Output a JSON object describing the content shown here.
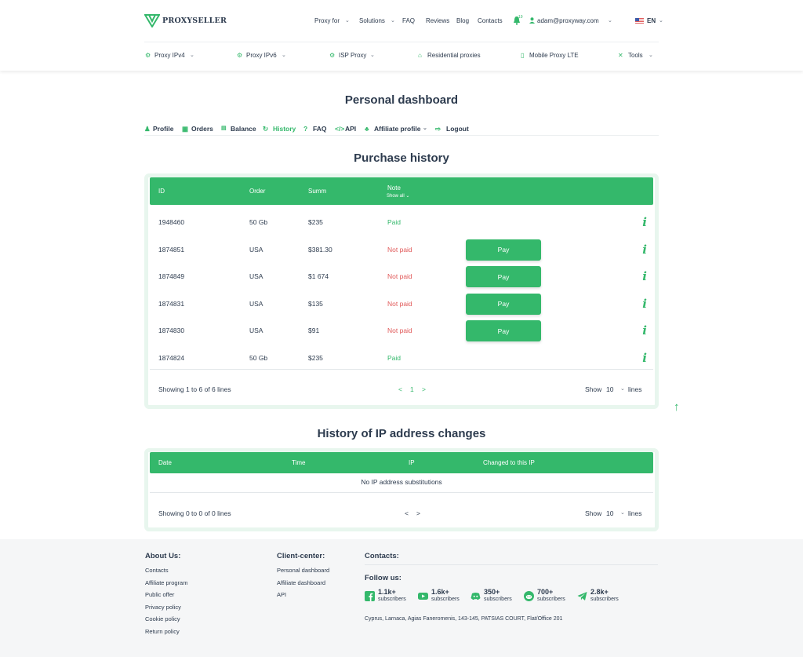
{
  "brand": {
    "name": "PROXYSELLER"
  },
  "topnav": {
    "proxy_for": "Proxy for",
    "solutions": "Solutions",
    "faq": "FAQ",
    "reviews": "Reviews",
    "blog": "Blog",
    "contacts": "Contacts",
    "notif_count": "19",
    "email": "adam@proxyway.com",
    "lang": "EN"
  },
  "menu": {
    "ipv4": "Proxy IPv4",
    "ipv6": "Proxy IPv6",
    "isp": "ISP Proxy",
    "residential": "Residential proxies",
    "mobile": "Mobile Proxy LTE",
    "tools": "Tools"
  },
  "page": {
    "title": "Personal dashboard"
  },
  "tabs": {
    "profile": "Profile",
    "orders": "Orders",
    "balance": "Balance",
    "history": "History",
    "faq": "FAQ",
    "api": "API",
    "affiliate": "Affiliate profile",
    "logout": "Logout"
  },
  "purchase": {
    "title": "Purchase history",
    "headers": {
      "id": "ID",
      "order": "Order",
      "summ": "Summ",
      "note": "Note",
      "show_all": "Show all"
    },
    "pay_label": "Pay",
    "rows": [
      {
        "id": "1948460",
        "order": "50 Gb",
        "summ": "$235",
        "status": "Paid"
      },
      {
        "id": "1874851",
        "order": "USA",
        "summ": "$381.30",
        "status": "Not paid"
      },
      {
        "id": "1874849",
        "order": "USA",
        "summ": "$1 674",
        "status": "Not paid"
      },
      {
        "id": "1874831",
        "order": "USA",
        "summ": "$135",
        "status": "Not paid"
      },
      {
        "id": "1874830",
        "order": "USA",
        "summ": "$91",
        "status": "Not paid"
      },
      {
        "id": "1874824",
        "order": "50 Gb",
        "summ": "$235",
        "status": "Paid"
      }
    ],
    "showing": "Showing 1 to 6 of 6 lines",
    "page": "1",
    "show_label": "Show",
    "show_value": "10",
    "lines_label": "lines"
  },
  "ip_history": {
    "title": "History of IP address changes",
    "headers": {
      "date": "Date",
      "time": "Time",
      "ip": "IP",
      "changed": "Changed to this IP"
    },
    "empty": "No IP address substitutions",
    "showing": "Showing 0 to 0 of 0 lines",
    "show_label": "Show",
    "show_value": "10",
    "lines_label": "lines"
  },
  "footer": {
    "about_title": "About Us:",
    "about_links": [
      "Contacts",
      "Affiliate program",
      "Public offer",
      "Privacy policy",
      "Cookie policy",
      "Return policy"
    ],
    "client_title": "Client-center:",
    "client_links": [
      "Personal dashboard",
      "Affiliate dashboard",
      "API"
    ],
    "contacts_title": "Contacts:",
    "follow_title": "Follow us:",
    "socials": [
      {
        "icon": "facebook-icon",
        "count": "1.1k+",
        "label": "subscribers"
      },
      {
        "icon": "youtube-icon",
        "count": "1.6k+",
        "label": "subscribers"
      },
      {
        "icon": "discord-icon",
        "count": "350+",
        "label": "subscribers"
      },
      {
        "icon": "reddit-icon",
        "count": "700+",
        "label": "subscribers"
      },
      {
        "icon": "telegram-icon",
        "count": "2.8k+",
        "label": "subscribers"
      }
    ],
    "address": "Cyprus, Larnaca, Agias Faneromenis, 143-145, PATSIAS COURT, Flat/Office 201"
  },
  "colors": {
    "accent": "#34b86b",
    "danger": "#e15a5a",
    "text": "#2d3b4e"
  }
}
